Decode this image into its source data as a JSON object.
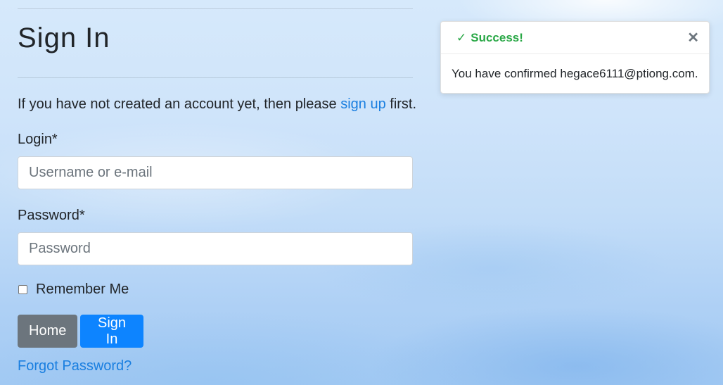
{
  "page": {
    "title": "Sign In"
  },
  "intro": {
    "before": "If you have not created an account yet, then please ",
    "link": "sign up",
    "after": " first."
  },
  "form": {
    "login_label": "Login*",
    "login_placeholder": "Username or e-mail",
    "login_value": "",
    "password_label": "Password*",
    "password_placeholder": "Password",
    "password_value": "",
    "remember_label": "Remember Me",
    "remember_checked": false
  },
  "buttons": {
    "home": "Home",
    "sign_in": "Sign In"
  },
  "forgot_password": "Forgot Password?",
  "toast": {
    "check_icon": "✓",
    "title": "Success!",
    "close_icon": "✕",
    "message": "You have confirmed hegace6111@ptiong.com."
  },
  "colors": {
    "link": "#1a7fe0",
    "primary_button": "#0d84ff",
    "secondary_button": "#6c757d",
    "success": "#28a745"
  }
}
